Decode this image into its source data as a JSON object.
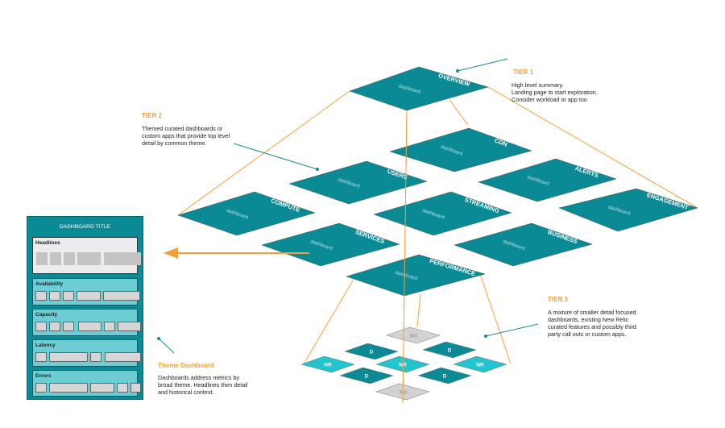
{
  "colors": {
    "teal": "#0a8a94",
    "light_teal": "#22c5cf",
    "gray_tile": "#d2d2d2",
    "orange": "#f5a03a",
    "callout": "#1a8a96"
  },
  "tier1": {
    "title": "TIER 1",
    "lines": [
      "High level summary.",
      "Landing page to start exploration.",
      "Consider workload or app too"
    ]
  },
  "tier2": {
    "title": "TIER 2",
    "lines": [
      "Themed curated dashboards or",
      "custom apps that provide top level",
      "detail by common theme."
    ]
  },
  "tier3": {
    "title": "TIER 3",
    "lines": [
      "A mixture of smaller detail focused",
      "dashboards, existing New Relic",
      "curated features and possibly third",
      "party call outs or custom apps."
    ]
  },
  "theme": {
    "title": "Theme Dashboard",
    "lines": [
      "Dashboards address metrics by",
      "broad theme. Headlines then detail",
      "and historical context."
    ]
  },
  "dashboards": [
    {
      "name": "OVERVIEW",
      "sub": "dashboard"
    },
    {
      "name": "CDN",
      "sub": "dashboard"
    },
    {
      "name": "USERS",
      "sub": "dashboard"
    },
    {
      "name": "ALERTS",
      "sub": "dashboard"
    },
    {
      "name": "COMPUTE",
      "sub": "dashboard"
    },
    {
      "name": "STREAMING",
      "sub": "dashboard"
    },
    {
      "name": "ENGAGEMENT",
      "sub": "dashboard"
    },
    {
      "name": "SERVICES",
      "sub": "dashboard"
    },
    {
      "name": "BUSINESS",
      "sub": "dashboard"
    },
    {
      "name": "PERFORMANCE",
      "sub": "dashboard"
    }
  ],
  "tier3_tiles": [
    {
      "label": "3rd",
      "kind": "third"
    },
    {
      "label": "D",
      "kind": "d"
    },
    {
      "label": "D",
      "kind": "d"
    },
    {
      "label": "NR",
      "kind": "nr"
    },
    {
      "label": "NR",
      "kind": "nr"
    },
    {
      "label": "NR",
      "kind": "nr"
    },
    {
      "label": "D",
      "kind": "d"
    },
    {
      "label": "D",
      "kind": "d"
    },
    {
      "label": "3rd",
      "kind": "third"
    }
  ],
  "panel": {
    "title": "DASHBOARD TITLE",
    "sections": [
      "Headlines",
      "Availability",
      "Capacity",
      "Latency",
      "Errors"
    ]
  }
}
